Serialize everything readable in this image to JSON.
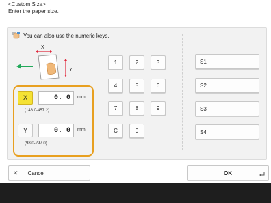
{
  "header": {
    "title": "<Custom Size>",
    "subtitle": "Enter the paper size."
  },
  "hint": "You can also use the numeric keys.",
  "diagram": {
    "x_label": "X",
    "y_label": "Y"
  },
  "keypad": {
    "keys": [
      "1",
      "2",
      "3",
      "4",
      "5",
      "6",
      "7",
      "8",
      "9",
      "C",
      "0"
    ]
  },
  "x_field": {
    "label": "X",
    "value": "0. 0",
    "unit": "mm",
    "range": "(148.0-457.2)"
  },
  "y_field": {
    "label": "Y",
    "value": "0. 0",
    "unit": "mm",
    "range": "(98.0-297.0)"
  },
  "stored_sizes": [
    "S1",
    "S2",
    "S3",
    "S4"
  ],
  "footer": {
    "cancel_label": "Cancel",
    "ok_label": "OK"
  },
  "colors": {
    "highlight": "#e8a020",
    "x_label_bg": "#f5e234",
    "arrow": "#e0283c",
    "green_arrow": "#22a95a"
  }
}
